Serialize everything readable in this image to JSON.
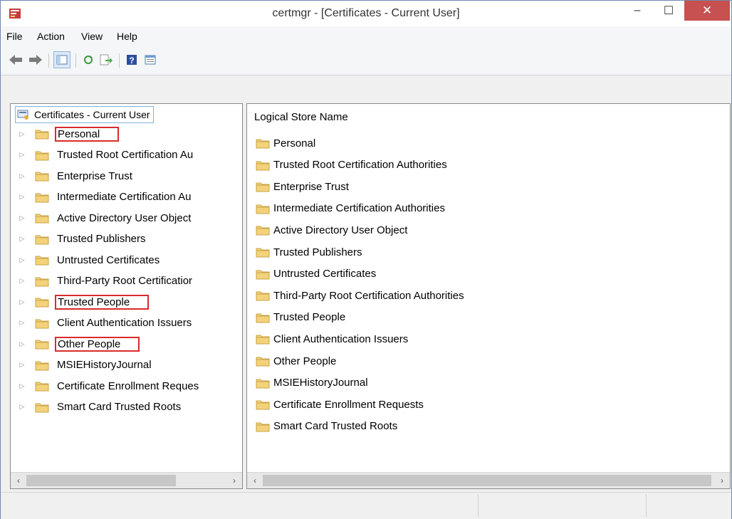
{
  "window": {
    "title": "certmgr - [Certificates - Current User]",
    "controls": {
      "minimize": "–",
      "maximize": "☐",
      "close": "✕"
    }
  },
  "menu": [
    "File",
    "Action",
    "View",
    "Help"
  ],
  "toolbar": {
    "icons": [
      "back-icon",
      "forward-icon",
      "show-hide-tree-icon",
      "refresh-icon",
      "export-list-icon",
      "help-icon",
      "properties-icon"
    ]
  },
  "tree": {
    "root": "Certificates - Current User",
    "items": [
      {
        "label": "Personal",
        "highlighted": true
      },
      {
        "label": "Trusted Root Certification Au",
        "highlighted": false
      },
      {
        "label": "Enterprise Trust",
        "highlighted": false
      },
      {
        "label": "Intermediate Certification Au",
        "highlighted": false
      },
      {
        "label": "Active Directory User Object",
        "highlighted": false
      },
      {
        "label": "Trusted Publishers",
        "highlighted": false
      },
      {
        "label": "Untrusted Certificates",
        "highlighted": false
      },
      {
        "label": "Third-Party Root Certificatior",
        "highlighted": false
      },
      {
        "label": "Trusted People",
        "highlighted": true
      },
      {
        "label": "Client Authentication Issuers",
        "highlighted": false
      },
      {
        "label": "Other People",
        "highlighted": true
      },
      {
        "label": "MSIEHistoryJournal",
        "highlighted": false
      },
      {
        "label": "Certificate Enrollment Reques",
        "highlighted": false
      },
      {
        "label": "Smart Card Trusted Roots",
        "highlighted": false
      }
    ]
  },
  "list": {
    "header": "Logical Store Name",
    "items": [
      "Personal",
      "Trusted Root Certification Authorities",
      "Enterprise Trust",
      "Intermediate Certification Authorities",
      "Active Directory User Object",
      "Trusted Publishers",
      "Untrusted Certificates",
      "Third-Party Root Certification Authorities",
      "Trusted People",
      "Client Authentication Issuers",
      "Other People",
      "MSIEHistoryJournal",
      "Certificate Enrollment Requests",
      "Smart Card Trusted Roots"
    ]
  },
  "colors": {
    "highlight": "#d92b2b",
    "folder": "#f3d27a",
    "close_button": "#c75050"
  }
}
